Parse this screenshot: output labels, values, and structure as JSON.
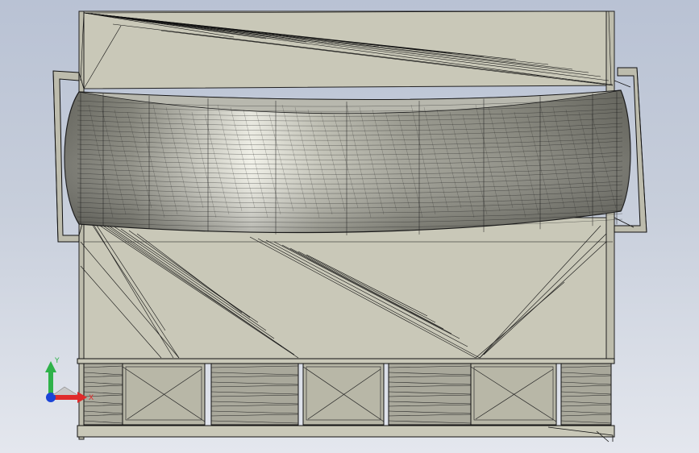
{
  "viewport": {
    "background_top": "#b9c2d4",
    "background_bottom": "#e4e7ee"
  },
  "model": {
    "face_color": "#c8c7b7",
    "edge_color": "#1e1e1e",
    "tire_colors": [
      "#6e6e66",
      "#828279",
      "#9d9d93",
      "#c8c8bd",
      "#e9e9df",
      "#c4c4b8",
      "#9b9b90",
      "#8b8b82",
      "#777770",
      "#6a6a63"
    ],
    "rollers_count": 6
  },
  "triad": {
    "y_label": "Y",
    "x_label": "X",
    "y_color": "#2fb24a",
    "x_color": "#e02b2b",
    "z_color": "#1b44d8"
  }
}
